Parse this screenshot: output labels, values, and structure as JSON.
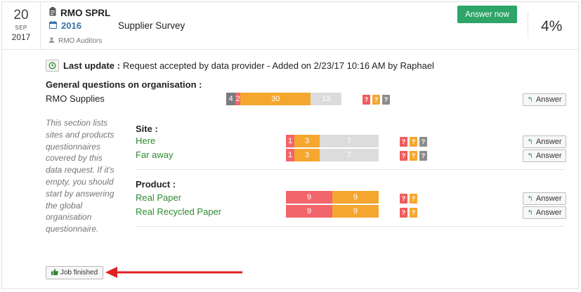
{
  "date": {
    "day": "20",
    "month": "SEP",
    "year": "2017"
  },
  "header": {
    "company": "RMO SPRL",
    "year": "2016",
    "survey": "Supplier Survey",
    "org": "RMO Auditors",
    "answer_now": "Answer now",
    "percent": "4%"
  },
  "last_update": {
    "label": "Last update :",
    "text": "Request accepted by data provider - Added on 2/23/17 10:16 AM by Raphael"
  },
  "general": {
    "title": "General questions on organisation :",
    "rows": [
      {
        "label": "RMO Supplies",
        "bar": [
          {
            "color": "dark",
            "value": 4
          },
          {
            "color": "red",
            "value": 2
          },
          {
            "color": "orange",
            "value": 30
          },
          {
            "color": "gray",
            "value": 13
          }
        ],
        "answer": "Answer"
      }
    ]
  },
  "side_note": "This section lists sites and products questionnaires covered by this data request. If it's empty, you should start by answering the global organisation questionnaire.",
  "site": {
    "title": "Site :",
    "rows": [
      {
        "label": "Here",
        "bar": [
          {
            "color": "red",
            "value": 1
          },
          {
            "color": "orange",
            "value": 3
          },
          {
            "color": "gray",
            "value": 7
          }
        ],
        "answer": "Answer"
      },
      {
        "label": "Far away",
        "bar": [
          {
            "color": "red",
            "value": 1
          },
          {
            "color": "orange",
            "value": 3
          },
          {
            "color": "gray",
            "value": 7
          }
        ],
        "answer": "Answer"
      }
    ]
  },
  "product": {
    "title": "Product :",
    "rows": [
      {
        "label": "Real Paper",
        "bar": [
          {
            "color": "red",
            "value": 9
          },
          {
            "color": "orange",
            "value": 9
          }
        ],
        "answer": "Answer"
      },
      {
        "label": "Real Recycled Paper",
        "bar": [
          {
            "color": "red",
            "value": 9
          },
          {
            "color": "orange",
            "value": 9
          }
        ],
        "answer": "Answer"
      }
    ]
  },
  "job_finished": "Job finished",
  "colors": {
    "green": "#2ea469",
    "red": "#f2656a",
    "orange": "#f5a62f",
    "gray": "#dcdcdc",
    "arrow": "#e02020"
  },
  "icons": [
    "clipboard-icon",
    "calendar-icon",
    "user-icon",
    "history-icon",
    "question-icon",
    "reply-arrow-icon",
    "thumbs-up-icon"
  ]
}
